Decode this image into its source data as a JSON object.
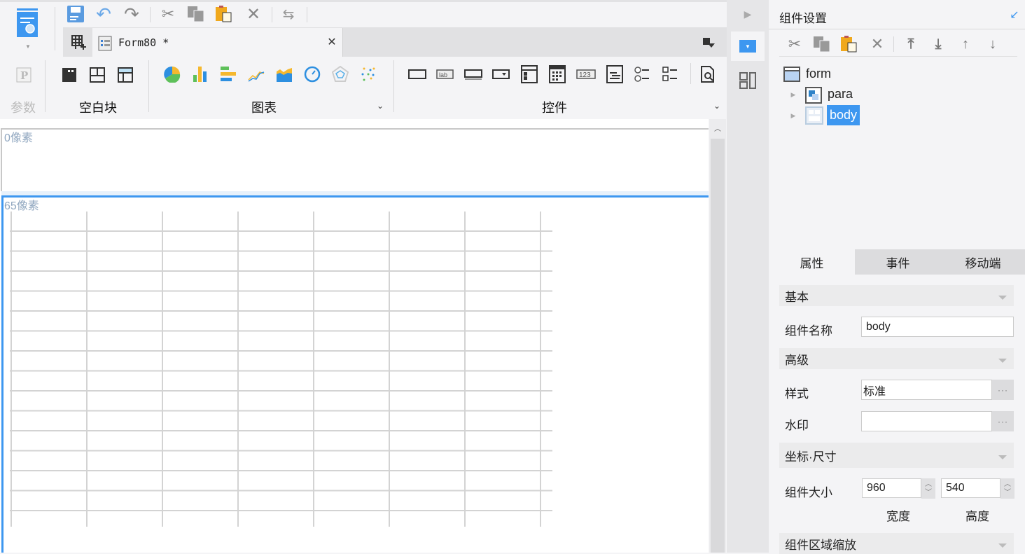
{
  "toolbar": {
    "tab_title": "Form80 *",
    "groups": {
      "param": "参数",
      "blank": "空白块",
      "chart": "图表",
      "widget": "控件"
    }
  },
  "canvas": {
    "para_label": "0像素",
    "body_label": "65像素"
  },
  "panel": {
    "title": "组件设置",
    "tree": [
      {
        "label": "form"
      },
      {
        "label": "para"
      },
      {
        "label": "body",
        "selected": true
      }
    ],
    "tabs": [
      "属性",
      "事件",
      "移动端"
    ],
    "sections": {
      "basic": "基本",
      "advanced": "高级",
      "position_size": "坐标·尺寸",
      "scale": "组件区域缩放"
    },
    "fields": {
      "name_label": "组件名称",
      "name_value": "body",
      "style_label": "样式",
      "style_value": "标准",
      "watermark_label": "水印",
      "watermark_value": "",
      "size_label": "组件大小",
      "width_value": "960",
      "height_value": "540",
      "width_caption": "宽度",
      "height_caption": "高度",
      "more": "···"
    }
  },
  "colors": {
    "accent": "#3d97f0",
    "selection": "#3d97f0",
    "grid": "#d3d3d3"
  }
}
